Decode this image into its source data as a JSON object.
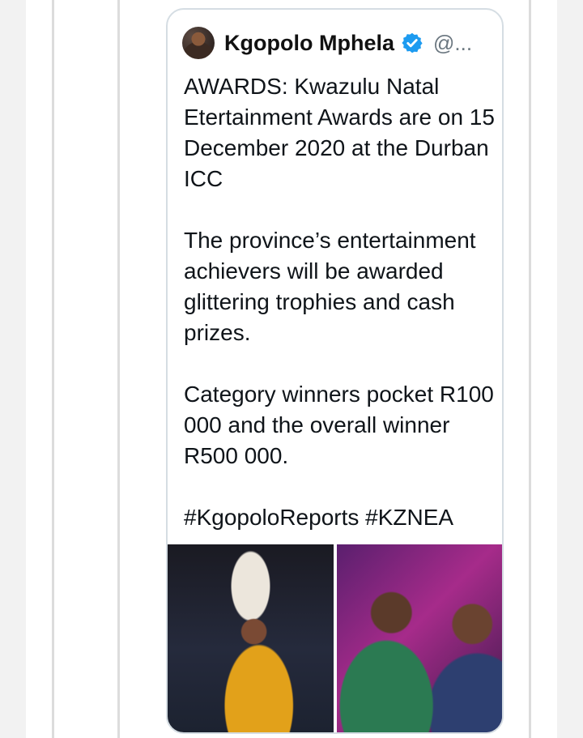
{
  "tweet": {
    "display_name": "Kgopolo Mphela",
    "handle": "@...",
    "verified": true,
    "body_paragraphs": [
      "AWARDS: Kwazulu Natal Etertainment Awards are on 15 December 2020 at the Durban ICC",
      "The province’s entertainment achievers will be awarded glittering trophies and cash prizes.",
      "Category winners pocket R100 000 and the overall winner R500 000.",
      "#KgopoloReports #KZNEA"
    ],
    "media_count": 2
  },
  "colors": {
    "verified_blue": "#1d9bf0",
    "border": "#d5dde3",
    "text": "#0f1419",
    "muted": "#6b7780"
  },
  "icons": {
    "verified": "verified-badge-icon",
    "avatar": "profile-avatar"
  }
}
